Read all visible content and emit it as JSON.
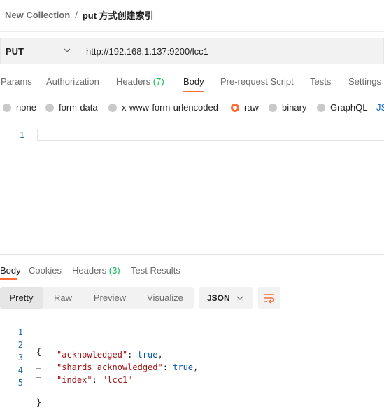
{
  "breadcrumb": {
    "collection": "New Collection",
    "separator": "/",
    "request_name": "put 方式创建索引"
  },
  "request": {
    "method": "PUT",
    "url": "http://192.168.1.137:9200/lcc1"
  },
  "request_tabs": {
    "params": "Params",
    "authorization": "Authorization",
    "headers": "Headers",
    "headers_count": "(7)",
    "body": "Body",
    "pre_request_script": "Pre-request Script",
    "tests": "Tests",
    "settings": "Settings",
    "active": "Body"
  },
  "body_types": {
    "none": "none",
    "form_data": "form-data",
    "urlencoded": "x-www-form-urlencoded",
    "raw": "raw",
    "binary": "binary",
    "graphql": "GraphQL",
    "format": "JS",
    "selected": "raw"
  },
  "editor": {
    "line_numbers": [
      "1"
    ],
    "content": ""
  },
  "response_tabs": {
    "body": "Body",
    "cookies": "Cookies",
    "headers": "Headers",
    "headers_count": "(3)",
    "test_results": "Test Results",
    "active": "Body"
  },
  "response_view": {
    "pretty": "Pretty",
    "raw": "Raw",
    "preview": "Preview",
    "visualize": "Visualize",
    "active": "Pretty",
    "language": "JSON"
  },
  "response_body": {
    "line_numbers": [
      "1",
      "2",
      "3",
      "4",
      "5"
    ],
    "open_brace": "{",
    "close_brace": "}",
    "fields": [
      {
        "key": "\"acknowledged\"",
        "value": "true",
        "comma": ","
      },
      {
        "key": "\"shards_acknowledged\"",
        "value": "true",
        "comma": ","
      },
      {
        "key": "\"index\"",
        "value": "\"lcc1\"",
        "comma": ""
      }
    ]
  },
  "icons": {
    "method_dropdown": "chevron-down-icon",
    "language_dropdown": "chevron-down-icon",
    "wrap": "wrap-lines-icon"
  },
  "colors": {
    "accent": "#ff6c37",
    "count_green": "#0cbb52",
    "link_blue": "#0a62c9",
    "json_key": "#a31515",
    "json_value": "#0451a5"
  }
}
